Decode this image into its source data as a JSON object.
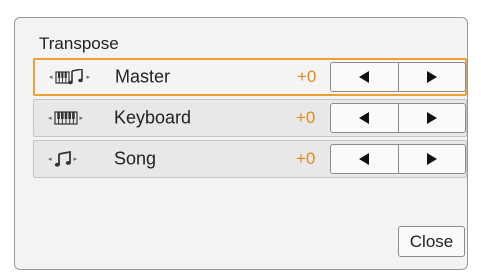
{
  "dialog": {
    "title": "Transpose",
    "accent_color": "#f0a030",
    "value_color": "#e08a1e",
    "close_label": "Close"
  },
  "rows": [
    {
      "label": "Master",
      "value": "+0",
      "icon": "piano-music-notes-icon",
      "selected": true
    },
    {
      "label": "Keyboard",
      "value": "+0",
      "icon": "piano-keyboard-icon",
      "selected": false
    },
    {
      "label": "Song",
      "value": "+0",
      "icon": "music-notes-icon",
      "selected": false
    }
  ],
  "icons": {
    "decrement": "left-triangle-icon",
    "increment": "right-triangle-icon"
  }
}
